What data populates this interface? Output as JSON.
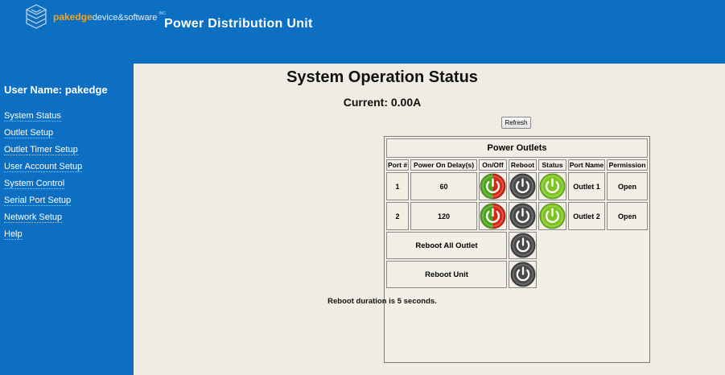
{
  "header": {
    "brand": "pakedge",
    "brand_sub": "device&software",
    "trademark": "INC",
    "title": "Power Distribution Unit"
  },
  "sidebar": {
    "user_label": "User Name: pakedge",
    "items": [
      {
        "label": "System Status"
      },
      {
        "label": "Outlet Setup"
      },
      {
        "label": "Outlet Timer Setup"
      },
      {
        "label": "User Account Setup"
      },
      {
        "label": "System Control"
      },
      {
        "label": "Serial Port Setup"
      },
      {
        "label": "Network Setup"
      },
      {
        "label": "Help"
      }
    ]
  },
  "main": {
    "title": "System Operation Status",
    "current": "Current: 0.00A",
    "refresh_label": "Refresh",
    "note": "Reboot duration is 5 seconds."
  },
  "outlets": {
    "title": "Power Outlets",
    "columns": [
      "Port #",
      "Power On Delay(s)",
      "On/Off",
      "Reboot",
      "Status",
      "Port Name",
      "Permission"
    ],
    "rows": [
      {
        "port": "1",
        "delay": "60",
        "onoff_icon": "power-on-off-icon",
        "reboot_icon": "reboot-icon",
        "status_icon": "status-on-icon",
        "name": "Outlet 1",
        "permission": "Open"
      },
      {
        "port": "2",
        "delay": "120",
        "onoff_icon": "power-on-off-icon",
        "reboot_icon": "reboot-icon",
        "status_icon": "status-on-icon",
        "name": "Outlet 2",
        "permission": "Open"
      }
    ],
    "reboot_all_label": "Reboot All Outlet",
    "reboot_unit_label": "Reboot Unit"
  },
  "colors": {
    "header_bg": "#0d6fc2",
    "content_bg": "#efede3",
    "onoff_red": "#d9281a",
    "onoff_green": "#4ca51f",
    "status_green": "#7cc41e",
    "reboot_gray": "#4a4a4a"
  }
}
